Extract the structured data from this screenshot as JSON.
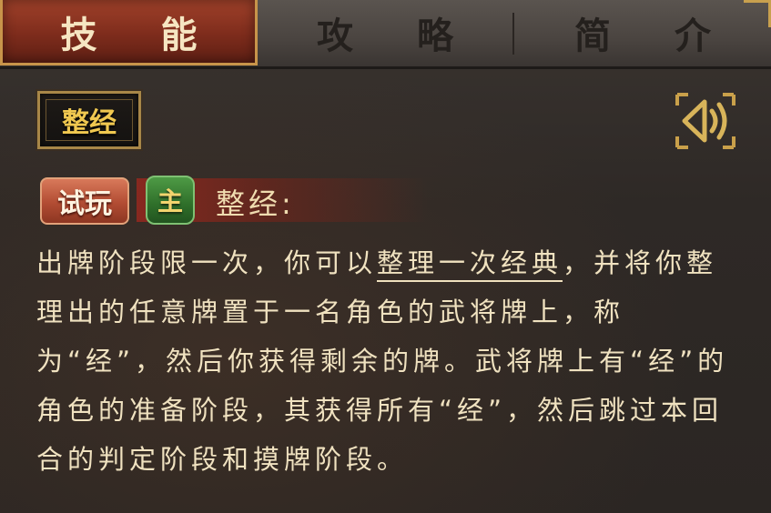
{
  "tabs": [
    {
      "label": "技 能",
      "active": true
    },
    {
      "label": "攻 略",
      "active": false
    },
    {
      "label": "简 介",
      "active": false
    }
  ],
  "skill": {
    "name": "整经",
    "title": "整经:",
    "try_label": "试玩",
    "lord_label": "主",
    "description_pre": "出牌阶段限一次，你可以",
    "description_keyword": "整理一次经典",
    "description_post": "，并将你整理出的任意牌置于一名角色的武将牌上，称为“经”，然后你获得剩余的牌。武将牌上有“经”的角色的准备阶段，其获得所有“经”，然后跳过本回合的判定阶段和摸牌阶段。"
  },
  "icons": {
    "sound": "speaker-icon"
  },
  "colors": {
    "active_tab": "#8a3322",
    "gold": "#f0c850",
    "text": "#f0e2c0",
    "try_button": "#c45d40",
    "lord_badge": "#3c8436"
  }
}
